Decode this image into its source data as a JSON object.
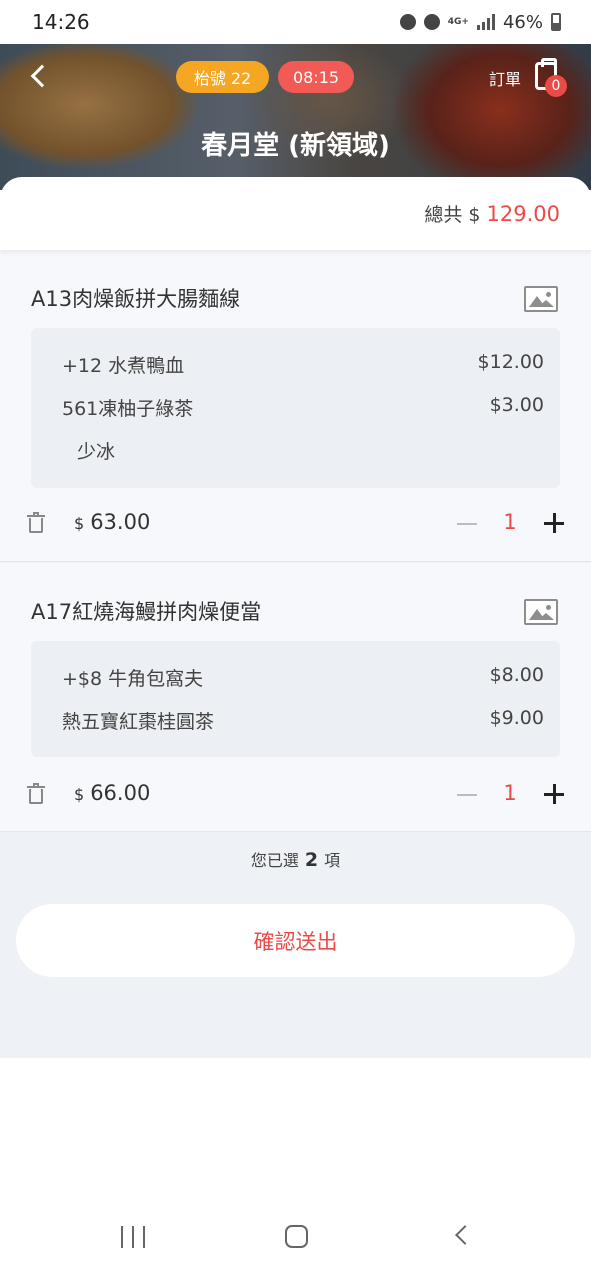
{
  "status_bar": {
    "time": "14:26",
    "network": "4G+",
    "battery": "46%"
  },
  "header": {
    "table_label": "枱號 22",
    "time_badge": "08:15",
    "order_label": "訂單",
    "cart_count": "0",
    "store_name": "春月堂 (新領域)"
  },
  "summary": {
    "total_label": "總共 $",
    "total_value": "129.00"
  },
  "items": [
    {
      "name": "A13肉燥飯拼大腸麵線",
      "options": [
        {
          "label": "+12 水煮鴨血",
          "price": "$12.00"
        },
        {
          "label": "561凍柚子綠茶",
          "price": "$3.00"
        }
      ],
      "note": "少冰",
      "currency": "$",
      "price": "63.00",
      "qty": "1"
    },
    {
      "name": "A17紅燒海鰻拼肉燥便當",
      "options": [
        {
          "label": "+$8 牛角包窩夫",
          "price": "$8.00"
        },
        {
          "label": "熱五寶紅棗桂圓茶",
          "price": "$9.00"
        }
      ],
      "currency": "$",
      "price": "66.00",
      "qty": "1"
    }
  ],
  "footer": {
    "selected_prefix": "您已選",
    "selected_count": "2",
    "selected_suffix": "項",
    "confirm_label": "確認送出"
  }
}
